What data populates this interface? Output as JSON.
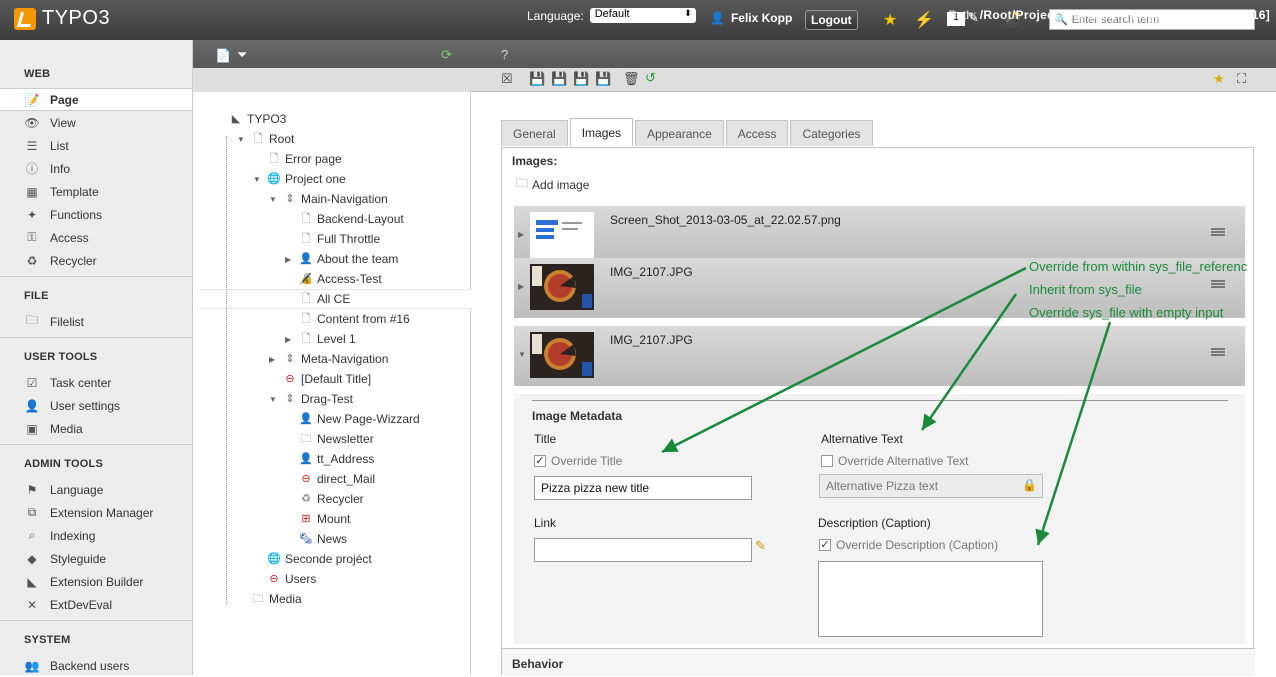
{
  "topbar": {
    "app_name": "TYPO3",
    "user_name": "Felix Kopp",
    "logout_label": "Logout",
    "workspace_count": "1",
    "search_placeholder": "Enter search term"
  },
  "modules": [
    {
      "group": "WEB",
      "items": [
        {
          "label": "Page",
          "icon": "page-edit-icon",
          "active": true
        },
        {
          "label": "View",
          "icon": "eye-icon"
        },
        {
          "label": "List",
          "icon": "list-icon"
        },
        {
          "label": "Info",
          "icon": "info-icon"
        },
        {
          "label": "Template",
          "icon": "template-icon"
        },
        {
          "label": "Functions",
          "icon": "wand-icon"
        },
        {
          "label": "Access",
          "icon": "key-icon"
        },
        {
          "label": "Recycler",
          "icon": "recycler-icon"
        }
      ]
    },
    {
      "group": "FILE",
      "items": [
        {
          "label": "Filelist",
          "icon": "folder-icon"
        }
      ]
    },
    {
      "group": "USER TOOLS",
      "items": [
        {
          "label": "Task center",
          "icon": "tasks-icon"
        },
        {
          "label": "User settings",
          "icon": "user-icon"
        },
        {
          "label": "Media",
          "icon": "media-icon"
        }
      ]
    },
    {
      "group": "ADMIN TOOLS",
      "items": [
        {
          "label": "Language",
          "icon": "flag-icon"
        },
        {
          "label": "Extension Manager",
          "icon": "extension-icon"
        },
        {
          "label": "Indexing",
          "icon": "indexing-icon"
        },
        {
          "label": "Styleguide",
          "icon": "styleguide-icon"
        },
        {
          "label": "Extension Builder",
          "icon": "typo3-icon"
        },
        {
          "label": "ExtDevEval",
          "icon": "x-icon"
        }
      ]
    },
    {
      "group": "SYSTEM",
      "items": [
        {
          "label": "Backend users",
          "icon": "users-icon"
        }
      ]
    }
  ],
  "docheader": {
    "language_label": "Language:",
    "language_value": "Default",
    "path_label": "Path:",
    "path_value": "/Root/Project one/Main-Navigation/",
    "record_label": "All CE [16]"
  },
  "tree": [
    {
      "label": "TYPO3",
      "depth": 0,
      "icon": "typo3"
    },
    {
      "label": "Root",
      "depth": 1,
      "icon": "page",
      "toggle": "open"
    },
    {
      "label": "Error page",
      "depth": 2,
      "icon": "page"
    },
    {
      "label": "Project one",
      "depth": 2,
      "icon": "globe",
      "toggle": "open"
    },
    {
      "label": "Main-Navigation",
      "depth": 3,
      "icon": "menu",
      "toggle": "open"
    },
    {
      "label": "Backend-Layout",
      "depth": 4,
      "icon": "page"
    },
    {
      "label": "Full Throttle",
      "depth": 4,
      "icon": "page"
    },
    {
      "label": "About the team",
      "depth": 4,
      "icon": "user",
      "toggle": "closed"
    },
    {
      "label": "Access-Test",
      "depth": 4,
      "icon": "page-lock"
    },
    {
      "label": "All CE",
      "depth": 4,
      "icon": "page",
      "selected": true
    },
    {
      "label": "Content from #16",
      "depth": 4,
      "icon": "page"
    },
    {
      "label": "Level 1",
      "depth": 4,
      "icon": "page",
      "toggle": "closed"
    },
    {
      "label": "Meta-Navigation",
      "depth": 3,
      "icon": "menu",
      "toggle": "closed"
    },
    {
      "label": "[Default Title]",
      "depth": 3,
      "icon": "page-hidden"
    },
    {
      "label": "Drag-Test",
      "depth": 3,
      "icon": "menu",
      "toggle": "open"
    },
    {
      "label": "New Page-Wizzard",
      "depth": 4,
      "icon": "user"
    },
    {
      "label": "Newsletter",
      "depth": 4,
      "icon": "folder"
    },
    {
      "label": "tt_Address",
      "depth": 4,
      "icon": "user"
    },
    {
      "label": "direct_Mail",
      "depth": 4,
      "icon": "page-hidden"
    },
    {
      "label": "Recycler",
      "depth": 4,
      "icon": "recycler"
    },
    {
      "label": "Mount",
      "depth": 4,
      "icon": "mount"
    },
    {
      "label": "News",
      "depth": 4,
      "icon": "news"
    },
    {
      "label": "Seconde projéct",
      "depth": 2,
      "icon": "globe"
    },
    {
      "label": "Users",
      "depth": 2,
      "icon": "page-hidden"
    },
    {
      "label": "Media",
      "depth": 1,
      "icon": "folder"
    }
  ],
  "tabs": [
    "General",
    "Images",
    "Appearance",
    "Access",
    "Categories"
  ],
  "images_section": {
    "label": "Images:",
    "add_label": "Add image",
    "files": [
      "Screen_Shot_2013-03-05_at_22.02.57.png",
      "IMG_2107.JPG",
      "IMG_2107.JPG"
    ]
  },
  "metadata": {
    "heading": "Image Metadata",
    "title_label": "Title",
    "override_title": "Override Title",
    "title_value": "Pizza pizza new title",
    "alt_label": "Alternative Text",
    "override_alt": "Override Alternative Text",
    "alt_value": "Alternative Pizza text",
    "link_label": "Link",
    "link_value": "",
    "desc_label": "Description (Caption)",
    "override_desc": "Override Description (Caption)",
    "desc_value": ""
  },
  "behavior_label": "Behavior",
  "annotations": [
    "Override from within sys_file_referenc",
    "Inherit from sys_file",
    "Override sys_file with empty input"
  ],
  "colors": {
    "brand": "#f49700",
    "annotation": "#1a8a3a"
  }
}
